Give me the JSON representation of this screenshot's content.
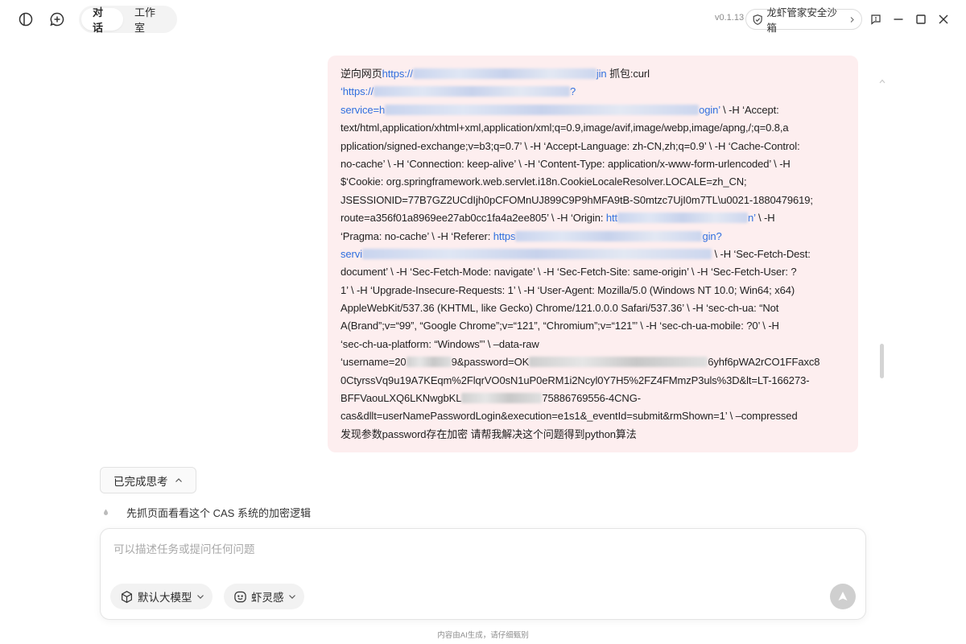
{
  "titlebar": {
    "tabs": [
      {
        "label": "对话",
        "active": true
      },
      {
        "label": "工作室",
        "active": false
      }
    ],
    "version": "v0.1.13",
    "sandbox_label": "龙虾管家安全沙箱",
    "icons": [
      "sidebar-toggle-icon",
      "new-chat-icon",
      "shield-icon",
      "chevron-right-icon",
      "feedback-icon",
      "minimize-icon",
      "maximize-icon",
      "close-icon"
    ]
  },
  "message": {
    "segments": {
      "l1_a": "逆向网页",
      "l1_link_a": "https://",
      "l1_link_b": "jin",
      "l1_b": " 抓包:curl",
      "l2_link_a": "‘https://",
      "l2_link_b": "?",
      "l3_link_a": "service=h",
      "l3_link_b": "ogin’",
      "l3_b": " \\ -H ‘Accept:",
      "l4": "text/html,application/xhtml+xml,application/xml;q=0.9,image/avif,image/webp,image/apng,/;q=0.8,a",
      "l5": "pplication/signed-exchange;v=b3;q=0.7’ \\ -H ‘Accept-Language: zh-CN,zh;q=0.9’ \\ -H ‘Cache-Control:",
      "l6": "no-cache’ \\ -H ‘Connection: keep-alive’ \\ -H ‘Content-Type: application/x-www-form-urlencoded’ \\ -H",
      "l7": "$‘Cookie: org.springframework.web.servlet.i18n.CookieLocaleResolver.LOCALE=zh_CN;",
      "l8": "JSESSIONID=77B7GZ2UCdIjh0pCFOMnUJ899C9P9hMFA9tB-S0mtzc7UjI0m7TL\\u0021-1880479619;",
      "l9_a": "route=a356f01a8969ee27ab0cc1fa4a2ee805’ \\ -H ‘Origin: ",
      "l9_link_a": "htt",
      "l9_link_b": "n’",
      "l9_b": " \\ -H",
      "l10_a": "‘Pragma: no-cache’ \\ -H ‘Referer: ",
      "l10_link_a": "https",
      "l10_link_b": "gin?",
      "l11_link_a": "servi",
      "l11_b": " \\ -H ‘Sec-Fetch-Dest:",
      "l12": "document’ \\ -H ‘Sec-Fetch-Mode: navigate’ \\ -H ‘Sec-Fetch-Site: same-origin’ \\ -H ‘Sec-Fetch-User: ?",
      "l13": "1’ \\ -H ‘Upgrade-Insecure-Requests: 1’ \\ -H ‘User-Agent: Mozilla/5.0 (Windows NT 10.0; Win64; x64)",
      "l14": "AppleWebKit/537.36 (KHTML, like Gecko) Chrome/121.0.0.0 Safari/537.36’ \\ -H ‘sec-ch-ua: “Not",
      "l15": "A(Brand”;v=“99”, “Google Chrome”;v=“121”, “Chromium”;v=“121”’ \\ -H ‘sec-ch-ua-mobile: ?0’ \\ -H",
      "l16": "‘sec-ch-ua-platform: “Windows”’ \\ –data-raw",
      "l17_a": "‘username=20",
      "l17_b": "9&password=OK",
      "l17_c": "6yhf6pWA2rCO1FFaxc8",
      "l18": "0CtyrssVq9u19A7KEqm%2FlqrVO0sN1uP0eRM1i2Ncyl0Y7H5%2FZ4FMmzP3uls%3D&lt=LT-166273-",
      "l19_a": "BFFVaouLXQ6LKNwgbKL",
      "l19_b": "75886769556-4CNG-",
      "l20": "cas&dllt=userNamePasswordLogin&execution=e1s1&_eventId=submit&rmShown=1’ \\ –compressed",
      "l21": "发现参数password存在加密 请帮我解决这个问题得到python算法"
    }
  },
  "thinking": {
    "label": "已完成思考",
    "step": "先抓页面看看这个 CAS 系统的加密逻辑"
  },
  "composer": {
    "placeholder": "可以描述任务或提问任何问题",
    "model_label": "默认大模型",
    "mode_label": "虾灵感"
  },
  "footer": "内容由AI生成，请仔细甄别",
  "colors": {
    "bubble_bg": "#fdeeef",
    "link": "#2f6fde",
    "send_bg": "#cfcfcf"
  }
}
